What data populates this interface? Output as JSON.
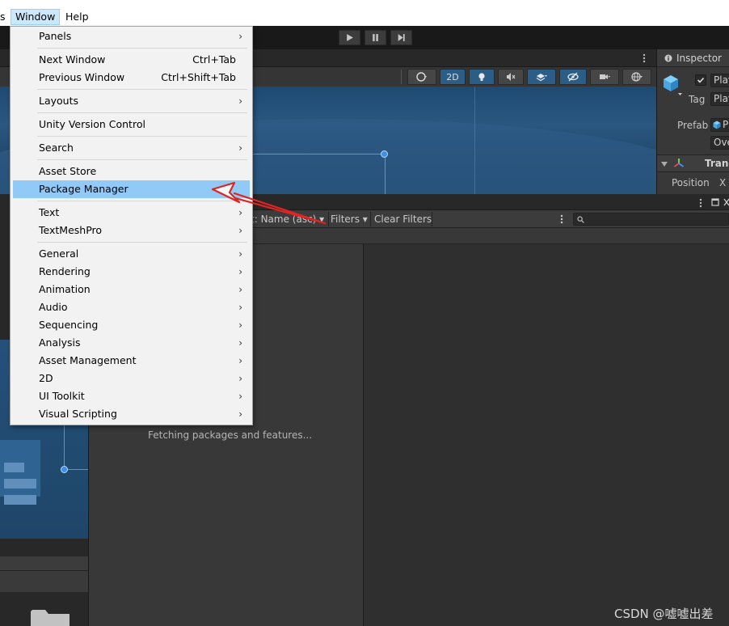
{
  "menubar": {
    "partial_left": "s",
    "window": "Window",
    "help": "Help"
  },
  "scene_toolbar": {
    "mode_2d": "2D"
  },
  "inspector": {
    "tab_label": "Inspector",
    "name_value": "Play",
    "tag_label": "Tag",
    "tag_value": "Play",
    "prefab_label": "Prefab",
    "prefab_value": "P",
    "overrides_value": "Ove",
    "transform_label": "Trans",
    "position_label": "Position",
    "x_label": "X"
  },
  "package_manager": {
    "sort_label": "t: Name (asc)",
    "filters_label": "Filters",
    "clear_filters_label": "Clear Filters",
    "status_text": "Fetching packages and features..."
  },
  "window_menu": {
    "items": [
      {
        "label": "Panels",
        "shortcut": "",
        "submenu": true
      },
      {
        "label": "Next Window",
        "shortcut": "Ctrl+Tab",
        "submenu": false
      },
      {
        "label": "Previous Window",
        "shortcut": "Ctrl+Shift+Tab",
        "submenu": false
      },
      {
        "label": "Layouts",
        "shortcut": "",
        "submenu": true
      },
      {
        "label": "Unity Version Control",
        "shortcut": "",
        "submenu": false
      },
      {
        "label": "Search",
        "shortcut": "",
        "submenu": true
      },
      {
        "label": "Asset Store",
        "shortcut": "",
        "submenu": false
      },
      {
        "label": "Package Manager",
        "shortcut": "",
        "submenu": false,
        "highlighted": true
      },
      {
        "label": "Text",
        "shortcut": "",
        "submenu": true
      },
      {
        "label": "TextMeshPro",
        "shortcut": "",
        "submenu": true
      },
      {
        "label": "General",
        "shortcut": "",
        "submenu": true
      },
      {
        "label": "Rendering",
        "shortcut": "",
        "submenu": true
      },
      {
        "label": "Animation",
        "shortcut": "",
        "submenu": true
      },
      {
        "label": "Audio",
        "shortcut": "",
        "submenu": true
      },
      {
        "label": "Sequencing",
        "shortcut": "",
        "submenu": true
      },
      {
        "label": "Analysis",
        "shortcut": "",
        "submenu": true
      },
      {
        "label": "Asset Management",
        "shortcut": "",
        "submenu": true
      },
      {
        "label": "2D",
        "shortcut": "",
        "submenu": true
      },
      {
        "label": "UI Toolkit",
        "shortcut": "",
        "submenu": true
      },
      {
        "label": "Visual Scripting",
        "shortcut": "",
        "submenu": true
      }
    ]
  },
  "watermark": "CSDN @嘘嘘出差",
  "colors": {
    "menu_highlight": "#91c9f7",
    "annotation_arrow": "#e02424",
    "scene_blue": "#2a5780"
  }
}
